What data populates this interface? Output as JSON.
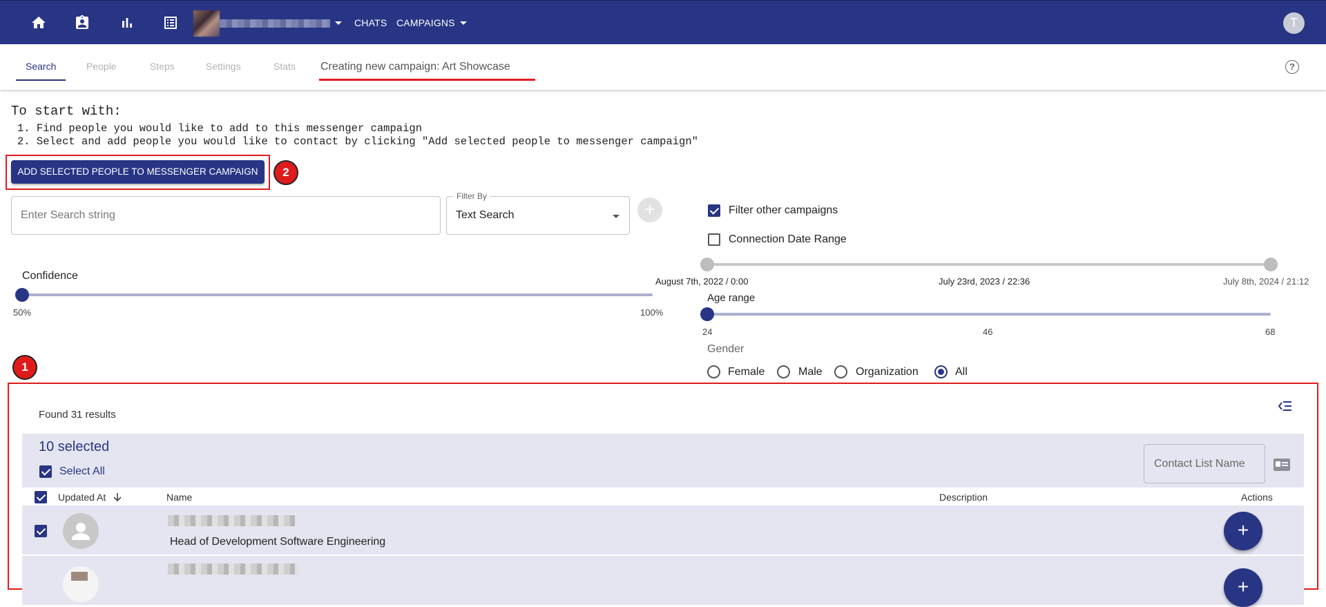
{
  "nav": {
    "icons": [
      "home-icon",
      "contact-card-icon",
      "bar-chart-icon",
      "list-icon"
    ],
    "chats": "CHATS",
    "campaigns": "CAMPAIGNS",
    "avatar_letter": "T"
  },
  "tabs": {
    "search": "Search",
    "people": "People",
    "steps": "Steps",
    "settings": "Settings",
    "stats": "Stats",
    "campaign_title": "Creating new campaign: Art Showcase"
  },
  "intro": {
    "heading": "To start with:",
    "step1": "1. Find people you would like to add to this messenger campaign",
    "step2": "2. Select and add people you would like to contact by clicking \"Add selected people to messenger campaign\""
  },
  "add_button": "ADD SELECTED PEOPLE TO MESSENGER CAMPAIGN",
  "badges": {
    "one": "1",
    "two": "2"
  },
  "search": {
    "placeholder": "Enter Search string",
    "filter_label": "Filter By",
    "filter_value": "Text Search"
  },
  "filters": {
    "filter_other": "Filter other campaigns",
    "filter_other_checked": true,
    "connection_date": "Connection Date Range",
    "connection_date_checked": false,
    "date_min": "August 7th, 2022 / 0:00",
    "date_mid": "July 23rd, 2023 / 22:36",
    "date_max": "July 8th, 2024 / 21:12",
    "age_label": "Age range",
    "age_min": "24",
    "age_mid": "46",
    "age_max": "68",
    "gender_label": "Gender",
    "gender_options": [
      "Female",
      "Male",
      "Organization",
      "All"
    ],
    "gender_selected": "All"
  },
  "confidence": {
    "label": "Confidence",
    "min": "50%",
    "max": "100%"
  },
  "results": {
    "found": "Found 31 results",
    "selected": "10 selected",
    "select_all": "Select All",
    "contact_list_placeholder": "Contact List Name",
    "columns": {
      "updated_at": "Updated At",
      "name": "Name",
      "description": "Description",
      "actions": "Actions"
    },
    "rows": [
      {
        "description": "Head of Development Software Engineering",
        "checked": true
      },
      {
        "description": "",
        "checked": false
      }
    ]
  },
  "colors": {
    "primary": "#283584",
    "highlight": "#e01b1b",
    "row_bg": "#e4e5f0"
  }
}
